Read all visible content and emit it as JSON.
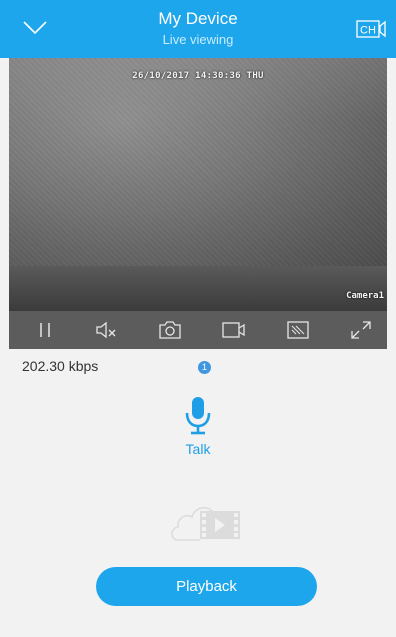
{
  "header": {
    "title": "My Device",
    "subtitle": "Live viewing",
    "back_icon": "chevron-down-icon",
    "channel_icon": "channel-switch-icon"
  },
  "video": {
    "timestamp": "26/10/2017 14:30:36 THU",
    "camera_label": "Camera1"
  },
  "controls": [
    {
      "name": "pause",
      "icon": "pause-icon"
    },
    {
      "name": "mute",
      "icon": "mute-icon"
    },
    {
      "name": "snapshot",
      "icon": "camera-icon"
    },
    {
      "name": "record",
      "icon": "video-record-icon"
    },
    {
      "name": "quality",
      "icon": "image-quality-icon"
    },
    {
      "name": "fullscreen",
      "icon": "fullscreen-icon"
    }
  ],
  "stats": {
    "bitrate": "202.30 kbps",
    "badge_count": "1"
  },
  "talk": {
    "label": "Talk",
    "icon": "microphone-icon"
  },
  "cloud": {
    "icon": "cloud-video-icon"
  },
  "playback": {
    "label": "Playback"
  },
  "colors": {
    "accent": "#1ea6ec",
    "controls_bar": "#5c5c5c",
    "background": "#f2f2f2"
  }
}
